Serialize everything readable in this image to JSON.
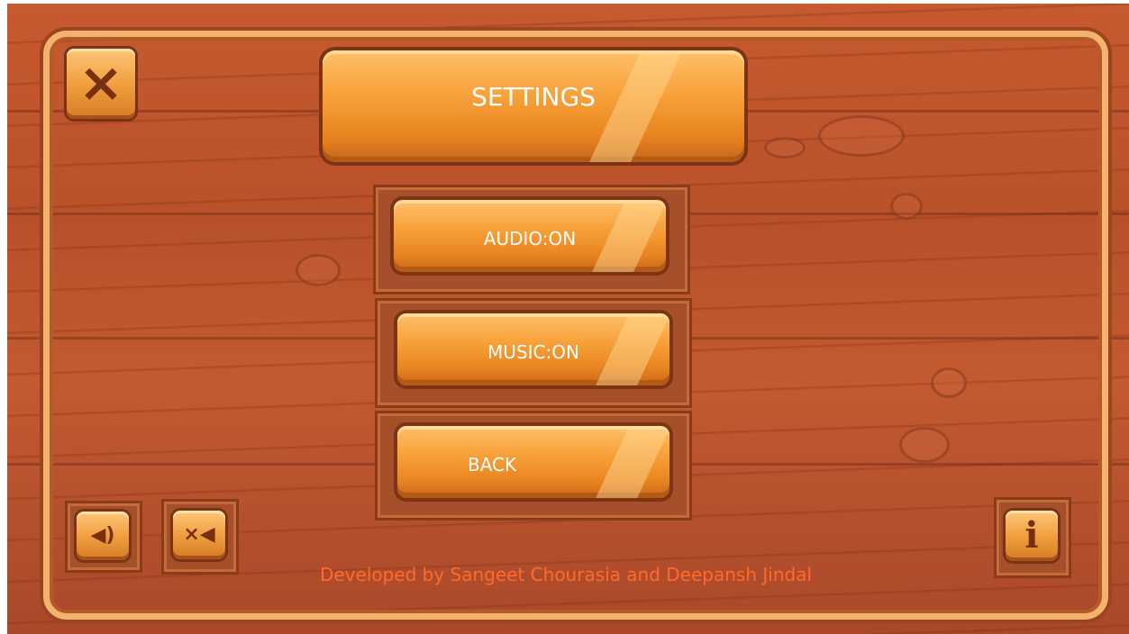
{
  "title": "SETTINGS",
  "menu": {
    "audio": "AUDIO:ON",
    "music": "MUSIC:ON",
    "back": "BACK"
  },
  "icons": {
    "close": "×",
    "sound_on": "◀)",
    "sound_off": "×◀",
    "info": "i"
  },
  "credit": "Developed by Sangeet Chourasia and Deepansh Jindal",
  "colors": {
    "wood": "#b8512a",
    "button": "#f7a13a",
    "frame": "#f2b36c",
    "credit": "#ff6a2a"
  }
}
